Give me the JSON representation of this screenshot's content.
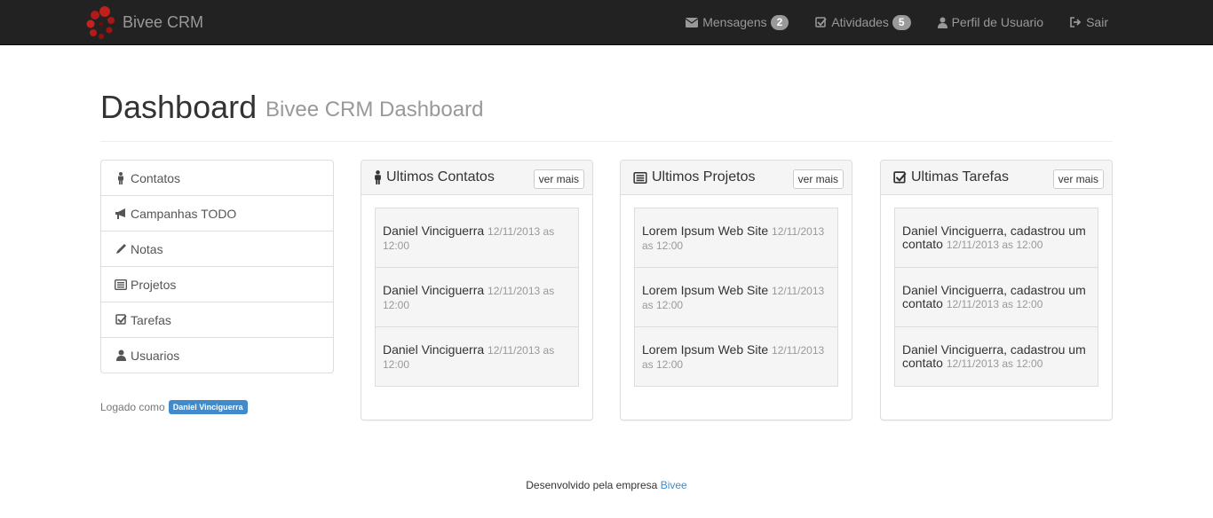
{
  "navbar": {
    "brand": "Bivee CRM",
    "items": [
      {
        "label": "Mensagens",
        "badge": "2",
        "icon": "envelope-icon"
      },
      {
        "label": "Atividades",
        "badge": "5",
        "icon": "check-square-icon"
      },
      {
        "label": "Perfil de Usuario",
        "badge": null,
        "icon": "user-icon"
      },
      {
        "label": "Sair",
        "badge": null,
        "icon": "sign-out-icon"
      }
    ]
  },
  "header": {
    "title": "Dashboard",
    "subtitle": "Bivee CRM Dashboard"
  },
  "sidebar": {
    "items": [
      {
        "label": "Contatos",
        "icon": "male-icon"
      },
      {
        "label": "Campanhas TODO",
        "icon": "bullhorn-icon"
      },
      {
        "label": "Notas",
        "icon": "pencil-icon"
      },
      {
        "label": "Projetos",
        "icon": "list-alt-icon"
      },
      {
        "label": "Tarefas",
        "icon": "check-square-icon"
      },
      {
        "label": "Usuarios",
        "icon": "user-icon"
      }
    ],
    "logged_prefix": "Logado como",
    "logged_user": "Daniel Vinciguerra"
  },
  "panels": [
    {
      "title": "Ultimos Contatos",
      "button": "ver mais",
      "items": [
        {
          "main": "Daniel Vinciguerra",
          "date": "12/11/2013 as 12:00"
        },
        {
          "main": "Daniel Vinciguerra",
          "date": "12/11/2013 as 12:00"
        },
        {
          "main": "Daniel Vinciguerra",
          "date": "12/11/2013 as 12:00"
        }
      ]
    },
    {
      "title": "Ultimos Projetos",
      "button": "ver mais",
      "items": [
        {
          "main": "Lorem Ipsum Web Site",
          "date": "12/11/2013 as 12:00"
        },
        {
          "main": "Lorem Ipsum Web Site",
          "date": "12/11/2013 as 12:00"
        },
        {
          "main": "Lorem Ipsum Web Site",
          "date": "12/11/2013 as 12:00"
        }
      ]
    },
    {
      "title": "Ultimas Tarefas",
      "button": "ver mais",
      "items": [
        {
          "main": "Daniel Vinciguerra, cadastrou um contato",
          "date": "12/11/2013 as 12:00"
        },
        {
          "main": "Daniel Vinciguerra, cadastrou um contato",
          "date": "12/11/2013 as 12:00"
        },
        {
          "main": "Daniel Vinciguerra, cadastrou um contato",
          "date": "12/11/2013 as 12:00"
        }
      ]
    }
  ],
  "footer": {
    "text": "Desenvolvido pela empresa",
    "link": "Bivee"
  },
  "colors": {
    "navbar": "#222222",
    "accent": "#428bca",
    "badge": "#999999",
    "logo": "#b22222"
  }
}
